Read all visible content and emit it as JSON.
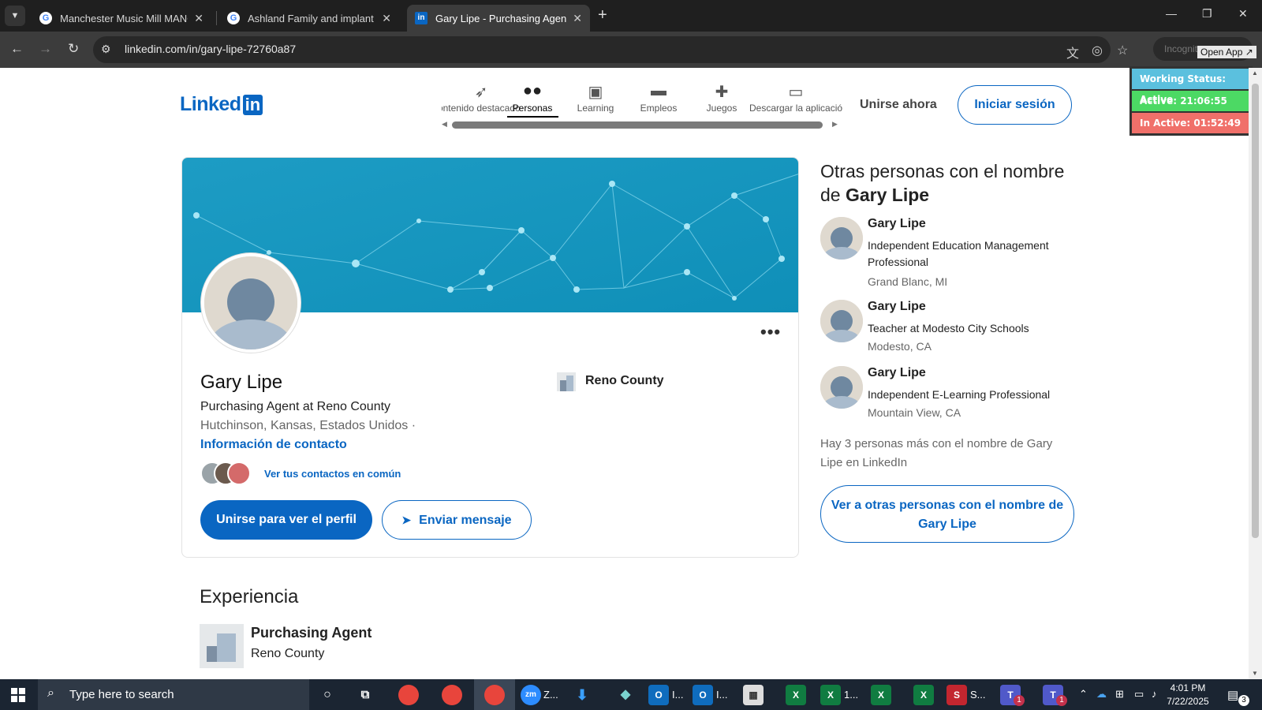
{
  "browser": {
    "tabs": [
      {
        "title": "Manchester Music Mill MANCH",
        "favicon": "google-icon",
        "active": false
      },
      {
        "title": "Ashland Family and implant De",
        "favicon": "google-icon",
        "active": false
      },
      {
        "title": "Gary Lipe - Purchasing Agent at",
        "favicon": "linkedin-icon",
        "active": true
      }
    ],
    "url": "linkedin.com/in/gary-lipe-72760a87",
    "incognito_label": "Incognito",
    "open_app_label": "Open App ↗"
  },
  "status_widget": {
    "working": "Working Status: Active",
    "active": "Active: 21:06:55",
    "inactive": "In Active: 01:52:49",
    "colors": {
      "working": "#5bc0de",
      "active": "#4cd964",
      "inactive": "#f0706a"
    }
  },
  "header": {
    "logo_word": "Linked",
    "logo_box": "in",
    "nav": [
      {
        "label": "Contenido destacado",
        "icon": "rocket-icon",
        "glyph": "🚀"
      },
      {
        "label": "Personas",
        "icon": "people-icon",
        "glyph": "👥",
        "active": true
      },
      {
        "label": "Learning",
        "icon": "video-icon",
        "glyph": "▶"
      },
      {
        "label": "Empleos",
        "icon": "briefcase-icon",
        "glyph": "💼"
      },
      {
        "label": "Juegos",
        "icon": "puzzle-icon",
        "glyph": "🧩"
      },
      {
        "label": "Descargar la aplicación",
        "icon": "laptop-icon",
        "glyph": "💻"
      }
    ],
    "join_now": "Unirse ahora",
    "sign_in": "Iniciar sesión"
  },
  "profile": {
    "name": "Gary Lipe",
    "headline": "Purchasing Agent at Reno County",
    "location": "Hutchinson, Kansas, Estados Unidos  ·",
    "contact_info": "Información de contacto",
    "mutual_connections": "Ver tus contactos en común",
    "join_button": "Unirse para ver el perfil",
    "message_button": "Enviar mensaje",
    "company": "Reno County",
    "more": "•••"
  },
  "sidebar": {
    "title_prefix": "Otras personas con el nombre de ",
    "title_name": "Gary Lipe",
    "people": [
      {
        "name": "Gary Lipe",
        "role": "Independent Education Management Professional",
        "location": "Grand Blanc, MI"
      },
      {
        "name": "Gary Lipe",
        "role": "Teacher at Modesto City Schools",
        "location": "Modesto, CA"
      },
      {
        "name": "Gary Lipe",
        "role": "Independent E-Learning Professional",
        "location": "Mountain View, CA"
      }
    ],
    "more_text": "Hay 3 personas más con el nombre de Gary Lipe en LinkedIn",
    "button_prefix": "Ver a otras personas con el nombre de ",
    "button_name": "Gary Lipe"
  },
  "experience": {
    "title": "Experiencia",
    "items": [
      {
        "role": "Purchasing Agent",
        "org": "Reno County"
      }
    ]
  },
  "taskbar": {
    "search_placeholder": "Type here to search",
    "zoom_label": "Z...",
    "outlook1_label": "I...",
    "outlook2_label": "I...",
    "excel2_label": "1...",
    "s_label": "S...",
    "teams_badge": "1",
    "teams2_badge": "1",
    "notifications": "3",
    "time": "4:01 PM",
    "date": "7/22/2025"
  }
}
